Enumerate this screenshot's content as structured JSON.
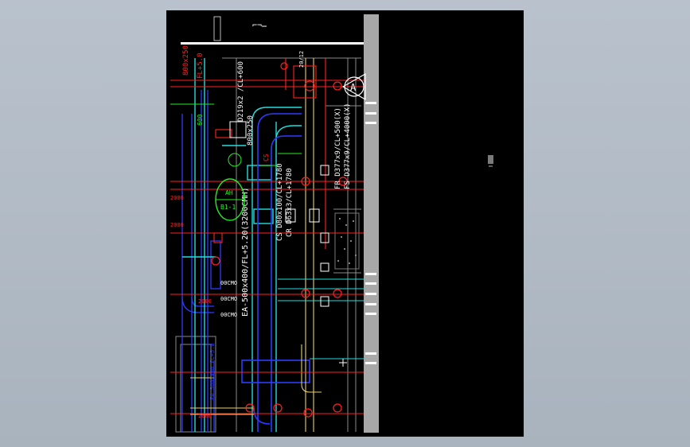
{
  "viewer": {
    "background": "#b0bac4",
    "sheet_background": "#000000"
  },
  "colors": {
    "red": "#ff2020",
    "green": "#22ee22",
    "cyan": "#22dddd",
    "blue": "#2a3cff",
    "white": "#ffffff",
    "yellow": "#e8d070",
    "gray": "#a8a8a8",
    "magenta": "#ff40ff"
  },
  "drawing": {
    "label_duct_top": "800x250",
    "label_fl_top": "FL+5.0",
    "label_dim_a": "600",
    "label_duct_vertical_1": "D219x2 /CL+600",
    "label_duct_vertical_2": "800x250",
    "label_cs_1": "CS",
    "label_a_marker": "A",
    "label_equipment": "B1-1",
    "label_equipment_sub": "AH",
    "label_eq_code": "20/12",
    "label_cs_pipe": "CS D80x100/CL+1780",
    "label_cr_pipe": "CR D63x3/CL+1780",
    "label_fr_pipe": "FR D377x9/CL+500(X)",
    "label_fs_pipe": "FS D377x9/CL+4000(X)",
    "label_ea_duct": "EA-500x400/FL+5.20(3200CMH)",
    "label_cmh_1": "00CMO",
    "label_cmh_2": "00CMO",
    "label_cmh_3": "00CMO",
    "label_side_1": "2000",
    "label_side_2": "2000",
    "label_side_3": "2000",
    "label_side_4": "2000",
    "label_vert_blue": "FA 500x400 FL+5.0"
  }
}
